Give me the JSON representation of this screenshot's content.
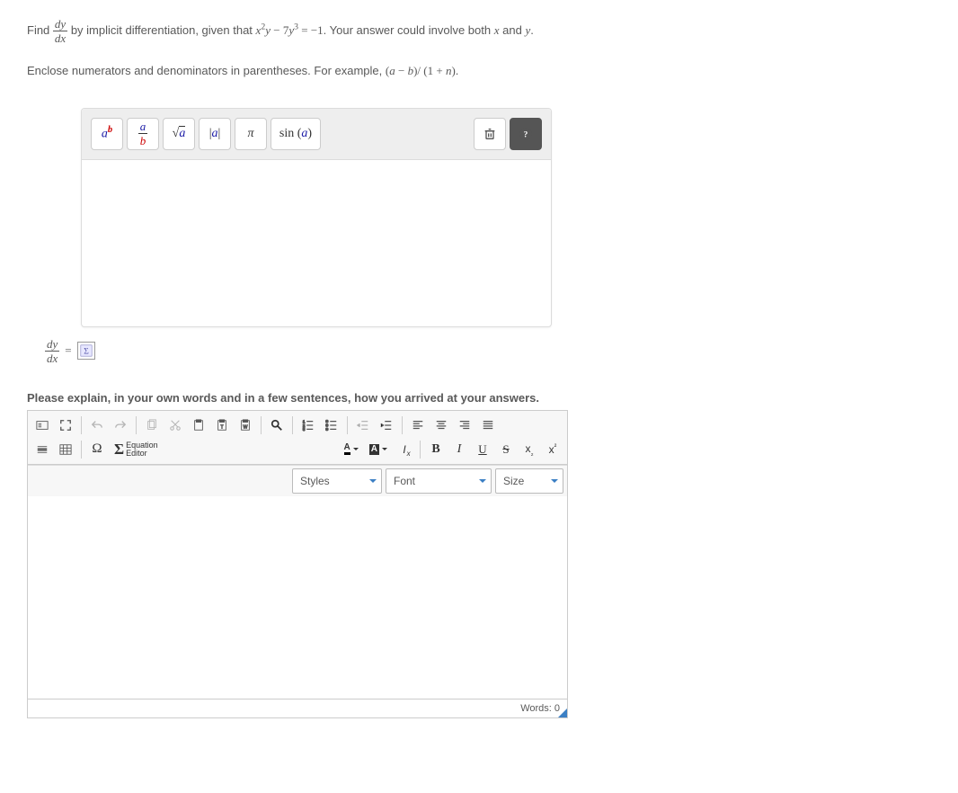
{
  "question": {
    "find_label": "Find",
    "dy": "dy",
    "dx": "dx",
    "by_implicit": "by implicit differentiation, given that",
    "equation_plain": "x²y − 7y³ = −1",
    "tail": ". Your answer could involve both",
    "var_x": "x",
    "and": "and",
    "var_y": "y",
    "period": ".",
    "enclose": "Enclose numerators and denominators in parentheses. For example,",
    "example": "(a − b)/ (1 + n)",
    "example_period": "."
  },
  "eq_editor": {
    "btn_exp_a": "a",
    "btn_exp_b": "b",
    "btn_frac_a": "a",
    "btn_frac_b": "b",
    "btn_sqrt": "a",
    "btn_abs": "|a|",
    "btn_pi": "π",
    "btn_sin": "sin (a)"
  },
  "answer_row": {
    "dy": "dy",
    "dx": "dx",
    "equals": "="
  },
  "explain_label": "Please explain, in your own words and in a few sentences, how you arrived at your answers.",
  "rich_editor": {
    "equation_editor_label": "Equation\nEditor",
    "styles": "Styles",
    "font": "Font",
    "size": "Size",
    "words_label": "Words: 0"
  }
}
